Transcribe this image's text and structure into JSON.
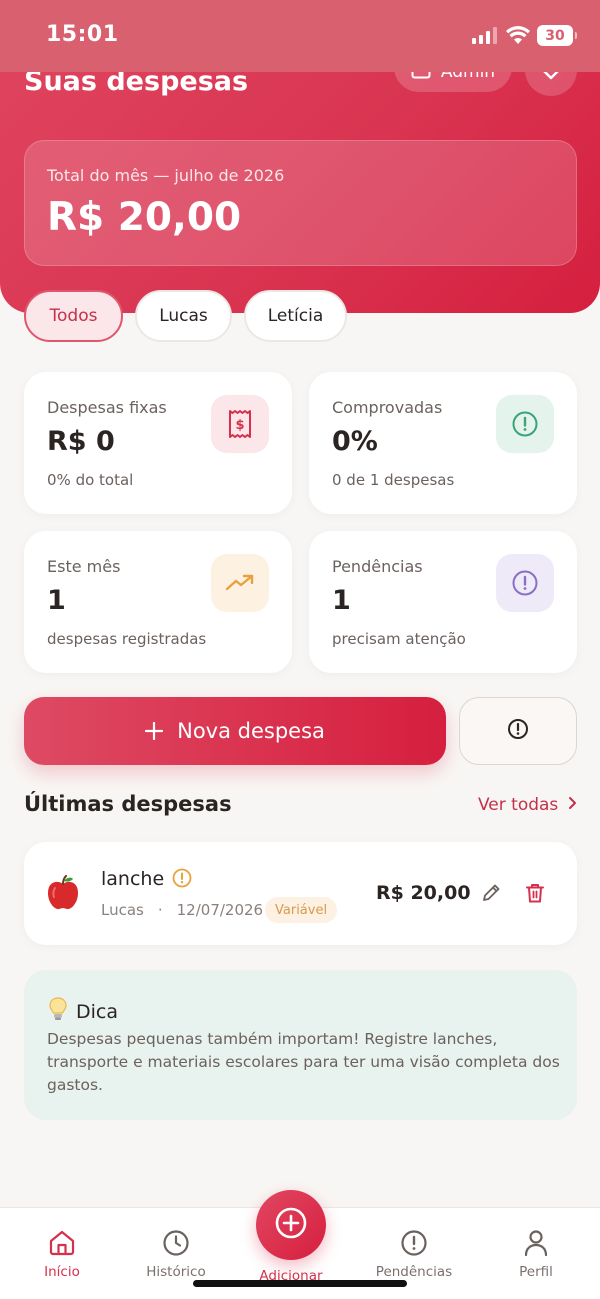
{
  "status_bar": {
    "time": "15:01",
    "battery": "30"
  },
  "header": {
    "title": "Suas despesas",
    "admin_label": "Admin",
    "total_label": "Total do mês — julho de 2026",
    "total_value": "R$ 20,00"
  },
  "filters": [
    {
      "label": "Todos",
      "active": true
    },
    {
      "label": "Lucas",
      "active": false
    },
    {
      "label": "Letícia",
      "active": false
    }
  ],
  "stats": {
    "fixed": {
      "label": "Despesas fixas",
      "value": "R$ 0",
      "sub": "0% do total",
      "icon": "receipt-dollar-icon",
      "color": "#d6304c"
    },
    "proven": {
      "label": "Comprovadas",
      "value": "0%",
      "sub": "0 de 1 despesas",
      "icon": "alert-circle-icon",
      "color": "#3aa37a"
    },
    "month": {
      "label": "Este mês",
      "value": "1",
      "sub": "despesas registradas",
      "icon": "trending-up-icon",
      "color": "#e9a13b"
    },
    "pending": {
      "label": "Pendências",
      "value": "1",
      "sub": "precisam atenção",
      "icon": "alert-circle-icon",
      "color": "#8a6fc4"
    }
  },
  "actions": {
    "new_expense": "Nova despesa"
  },
  "latest": {
    "title": "Últimas despesas",
    "see_all": "Ver todas",
    "items": [
      {
        "emoji": "apple-icon",
        "name": "lanche",
        "person": "Lucas",
        "separator": "·",
        "date": "12/07/2026",
        "tag": "Variável",
        "amount": "R$ 20,00"
      }
    ]
  },
  "tip": {
    "title": "Dica",
    "text": "Despesas pequenas também importam! Registre lanches, transporte e materiais escolares para ter uma visão completa dos gastos."
  },
  "nav": {
    "home": "Início",
    "history": "Histórico",
    "add": "Adicionar",
    "pending": "Pendências",
    "profile": "Perfil"
  },
  "colors": {
    "brand": "#d6304c",
    "background": "#f8f6f4"
  }
}
